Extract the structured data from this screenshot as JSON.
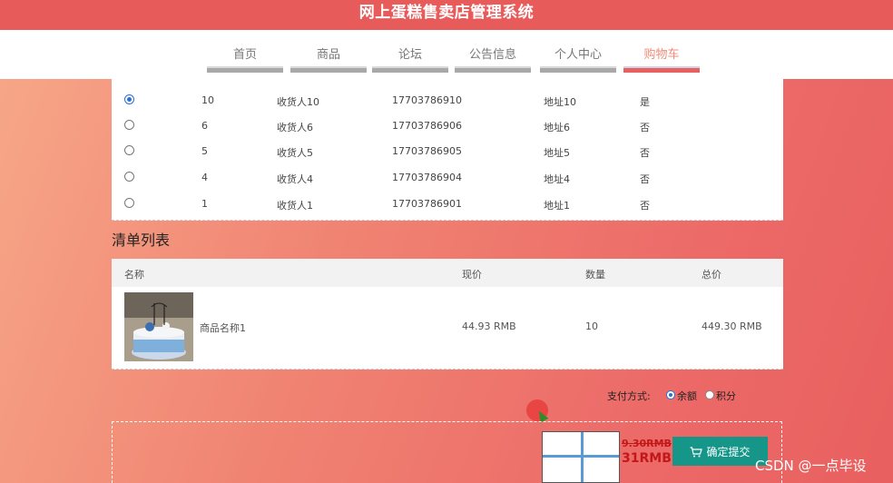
{
  "app": {
    "title": "网上蛋糕售卖店管理系统"
  },
  "nav": {
    "items": [
      {
        "label": "首页"
      },
      {
        "label": "商品"
      },
      {
        "label": "论坛"
      },
      {
        "label": "公告信息"
      },
      {
        "label": "个人中心"
      },
      {
        "label": "购物车"
      }
    ],
    "active_index": 5
  },
  "addresses": [
    {
      "selected": true,
      "id": "10",
      "name": "收货人10",
      "phone": "17703786910",
      "address": "地址10",
      "default": "是"
    },
    {
      "selected": false,
      "id": "6",
      "name": "收货人6",
      "phone": "17703786906",
      "address": "地址6",
      "default": "否"
    },
    {
      "selected": false,
      "id": "5",
      "name": "收货人5",
      "phone": "17703786905",
      "address": "地址5",
      "default": "否"
    },
    {
      "selected": false,
      "id": "4",
      "name": "收货人4",
      "phone": "17703786904",
      "address": "地址4",
      "default": "否"
    },
    {
      "selected": false,
      "id": "1",
      "name": "收货人1",
      "phone": "17703786901",
      "address": "地址1",
      "default": "否"
    }
  ],
  "order_list": {
    "title": "清单列表",
    "headers": {
      "name": "名称",
      "price": "现价",
      "quantity": "数量",
      "total": "总价"
    },
    "rows": [
      {
        "name": "商品名称1",
        "price": "44.93 RMB",
        "quantity": "10",
        "total": "449.30 RMB"
      }
    ]
  },
  "payment": {
    "label": "支付方式:",
    "options": [
      {
        "label": "余额",
        "selected": true
      },
      {
        "label": "积分",
        "selected": false
      }
    ]
  },
  "checkout": {
    "original_price": "9.30RMB",
    "final_price": "31RMB",
    "submit_label": "确定提交"
  },
  "watermark": "CSDN @一点毕设",
  "colors": {
    "accent": "#e85b5b",
    "submit": "#159689",
    "price": "#c21818",
    "radio": "#2a6fd6"
  }
}
